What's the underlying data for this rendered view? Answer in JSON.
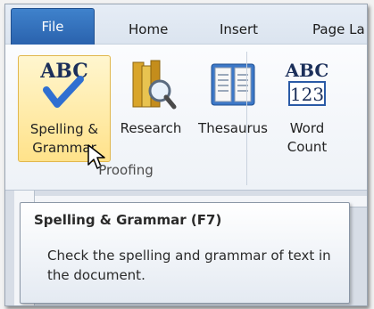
{
  "tabs": [
    {
      "label": "File",
      "active": true
    },
    {
      "label": "Home"
    },
    {
      "label": "Insert"
    },
    {
      "label": "Page La"
    }
  ],
  "ribbon": {
    "group": "Proofing",
    "buttons": [
      {
        "label": "Spelling &\nGrammar",
        "icon": "spelling-grammar-icon",
        "icon_text": "ABC",
        "hovered": true
      },
      {
        "label": "Research",
        "icon": "research-icon"
      },
      {
        "label": "Thesaurus",
        "icon": "thesaurus-icon"
      },
      {
        "label": "Word\nCount",
        "icon": "word-count-icon",
        "icon_text_top": "ABC",
        "icon_text_bottom": "123"
      }
    ]
  },
  "tooltip": {
    "title": "Spelling & Grammar (F7)",
    "description": "Check the spelling and grammar of text in the document."
  },
  "colors": {
    "file_tab": "#2a62ad",
    "hover_fill": "#ffe28a",
    "hover_border": "#e1b74d"
  }
}
